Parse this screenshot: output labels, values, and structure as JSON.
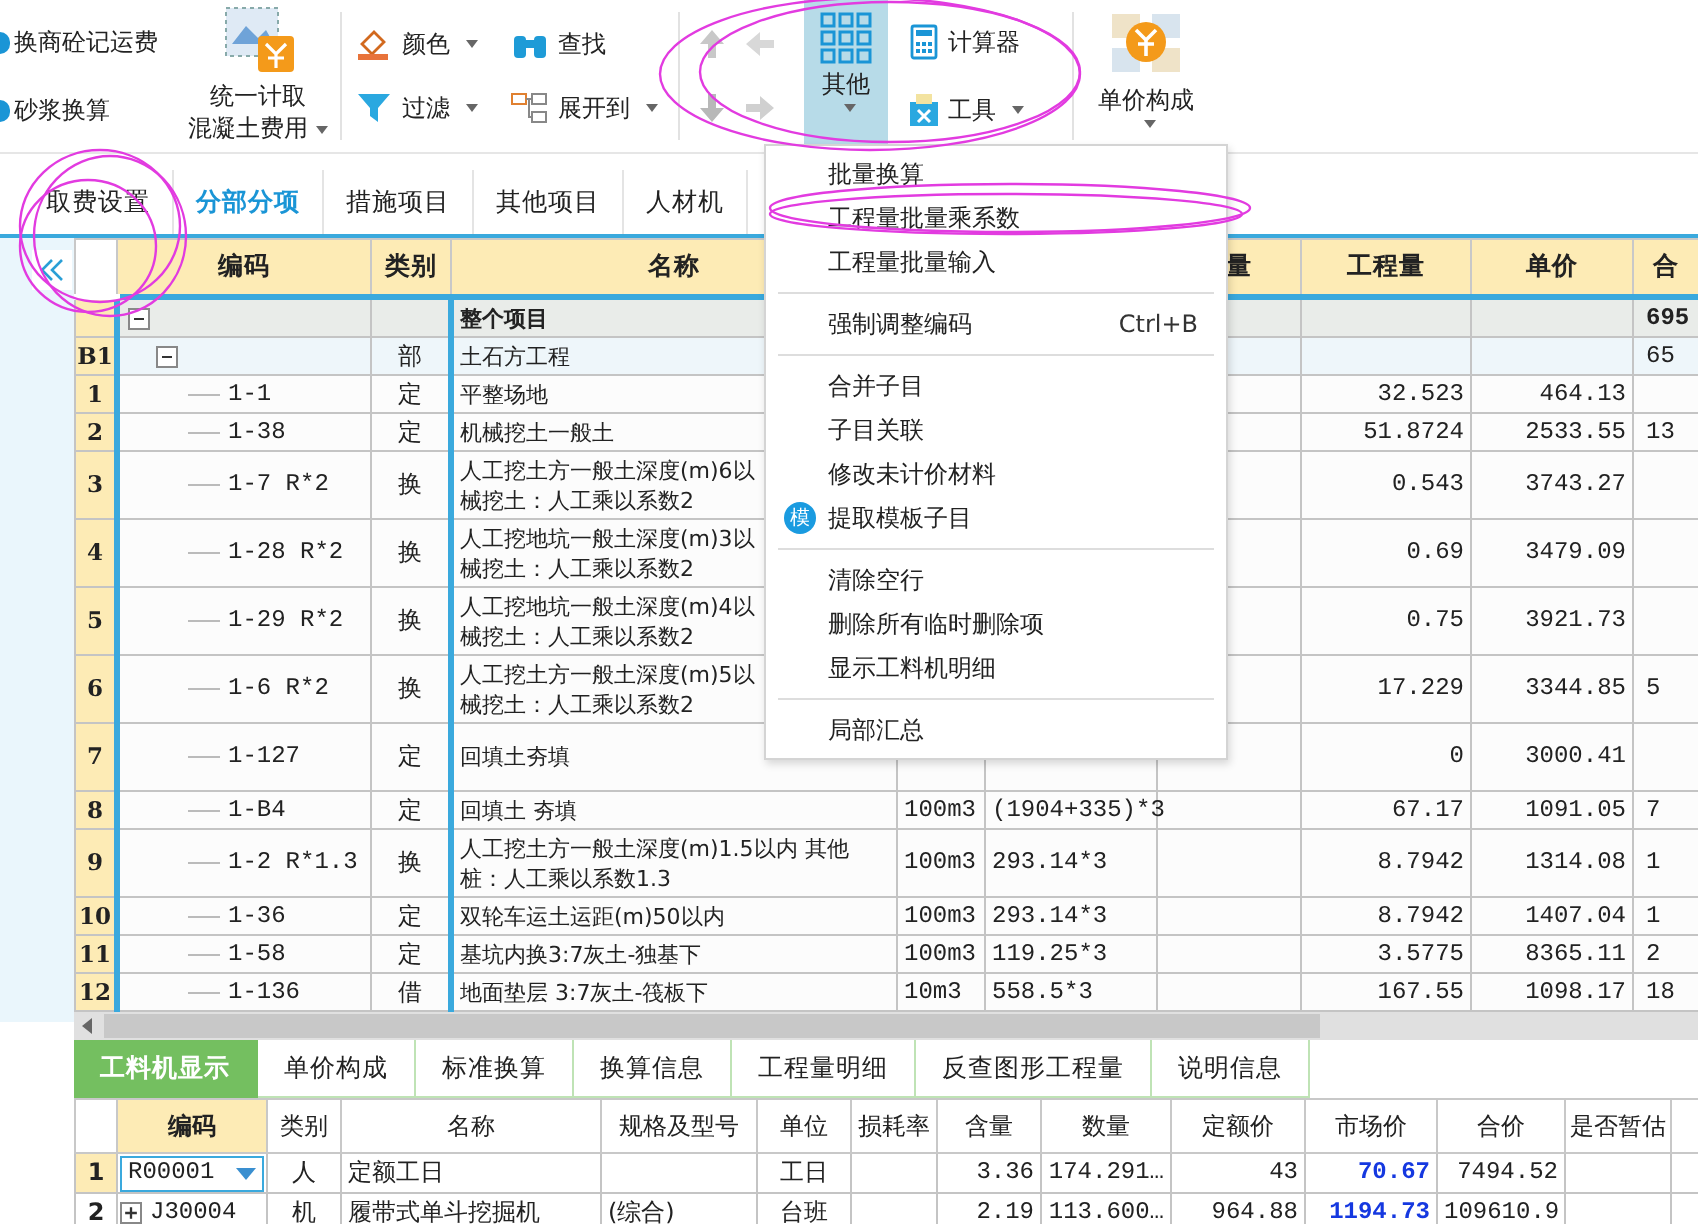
{
  "toolbar": {
    "left_items": [
      {
        "label": "换商砼记运费"
      },
      {
        "label": "砂浆换算"
      }
    ],
    "unified_button": {
      "label_lines": [
        "统一计取",
        "混凝土费用"
      ],
      "dropdown": true
    },
    "small_items": [
      {
        "label": "颜色",
        "dropdown": true
      },
      {
        "label": "查找",
        "dropdown": false
      },
      {
        "label": "过滤",
        "dropdown": true
      },
      {
        "label": "展开到",
        "dropdown": true
      }
    ],
    "other_button": {
      "label": "其他",
      "selected": true
    },
    "tool_items": [
      {
        "label": "计算器",
        "dropdown": false
      },
      {
        "label": "工具",
        "dropdown": true
      }
    ],
    "price_button": {
      "label": "单价构成"
    }
  },
  "tabs": [
    {
      "label": "取费设置",
      "selected": false
    },
    {
      "label": "分部分项",
      "selected": true
    },
    {
      "label": "措施项目",
      "selected": false
    },
    {
      "label": "其他项目",
      "selected": false
    },
    {
      "label": "人材机",
      "selected": false
    }
  ],
  "table": {
    "columns": [
      "",
      "编码",
      "类别",
      "名称",
      "",
      "",
      "量",
      "工程量",
      "单价",
      "合"
    ],
    "rows": [
      {
        "kind": "project",
        "row_no": "",
        "code": "",
        "type": "",
        "name_lines": [
          "整个项目"
        ],
        "unit": "",
        "expression": "",
        "quantity": "",
        "price": "",
        "total": "695",
        "expanded": true
      },
      {
        "kind": "section",
        "row_no": "B1",
        "code": "",
        "type": "部",
        "name_lines": [
          "土石方工程"
        ],
        "unit": "",
        "expression": "",
        "quantity": "",
        "price": "",
        "total": "65",
        "expanded": true
      },
      {
        "kind": "item",
        "row_no": "1",
        "code": "1-1",
        "type": "定",
        "name_lines": [
          "平整场地"
        ],
        "unit": "",
        "expression": "",
        "quantity": "32.523",
        "price": "464.13",
        "total": ""
      },
      {
        "kind": "item",
        "row_no": "2",
        "code": "1-38",
        "type": "定",
        "name_lines": [
          "机械挖土一般土"
        ],
        "unit": "",
        "expression": "",
        "quantity": "51.8724",
        "price": "2533.55",
        "total": "13"
      },
      {
        "kind": "item",
        "row_no": "3",
        "code": "1-7 R*2",
        "type": "换",
        "name_lines": [
          "人工挖土方一般土深度(m)6以",
          "械挖土：人工乘以系数2"
        ],
        "unit": "",
        "expression": "",
        "quantity": "0.543",
        "price": "3743.27",
        "total": ""
      },
      {
        "kind": "item",
        "row_no": "4",
        "code": "1-28 R*2",
        "type": "换",
        "name_lines": [
          "人工挖地坑一般土深度(m)3以",
          "械挖土：人工乘以系数2"
        ],
        "unit": "",
        "expression": "",
        "quantity": "0.69",
        "price": "3479.09",
        "total": ""
      },
      {
        "kind": "item",
        "row_no": "5",
        "code": "1-29 R*2",
        "type": "换",
        "name_lines": [
          "人工挖地坑一般土深度(m)4以",
          "械挖土：人工乘以系数2"
        ],
        "unit": "",
        "expression": "",
        "quantity": "0.75",
        "price": "3921.73",
        "total": ""
      },
      {
        "kind": "item",
        "row_no": "6",
        "code": "1-6 R*2",
        "type": "换",
        "name_lines": [
          "人工挖土方一般土深度(m)5以",
          "械挖土：人工乘以系数2"
        ],
        "unit": "",
        "expression": "",
        "quantity": "17.229",
        "price": "3344.85",
        "total": "5"
      },
      {
        "kind": "item",
        "row_no": "7",
        "code": "1-127",
        "type": "定",
        "name_lines": [
          "回填土夯填"
        ],
        "unit": "",
        "expression": "",
        "quantity": "0",
        "price": "3000.41",
        "total": "",
        "tall": true
      },
      {
        "kind": "item",
        "row_no": "8",
        "code": "1-B4",
        "type": "定",
        "name_lines": [
          "回填土 夯填"
        ],
        "unit": "100m3",
        "expression": "(1904+335)*3",
        "quantity": "67.17",
        "price": "1091.05",
        "total": "7"
      },
      {
        "kind": "item",
        "row_no": "9",
        "code": "1-2 R*1.3",
        "type": "换",
        "name_lines": [
          "人工挖土方一般土深度(m)1.5以内 其他",
          "桩：人工乘以系数1.3"
        ],
        "unit": "100m3",
        "expression": "293.14*3",
        "quantity": "8.7942",
        "price": "1314.08",
        "total": "1"
      },
      {
        "kind": "item",
        "row_no": "10",
        "code": "1-36",
        "type": "定",
        "name_lines": [
          "双轮车运土运距(m)50以内"
        ],
        "unit": "100m3",
        "expression": "293.14*3",
        "quantity": "8.7942",
        "price": "1407.04",
        "total": "1"
      },
      {
        "kind": "item",
        "row_no": "11",
        "code": "1-58",
        "type": "定",
        "name_lines": [
          "基坑内换3:7灰土-独基下"
        ],
        "unit": "100m3",
        "expression": "119.25*3",
        "quantity": "3.5775",
        "price": "8365.11",
        "total": "2"
      },
      {
        "kind": "item",
        "row_no": "12",
        "code": "1-136",
        "type": "借",
        "name_lines": [
          "地面垫层 3:7灰土-筏板下"
        ],
        "unit": "10m3",
        "expression": "558.5*3",
        "quantity": "167.55",
        "price": "1098.17",
        "total": "18"
      }
    ]
  },
  "context_menu": [
    {
      "kind": "item",
      "label": "批量换算"
    },
    {
      "kind": "item",
      "label": "工程量批量乘系数"
    },
    {
      "kind": "item",
      "label": "工程量批量输入"
    },
    {
      "kind": "separator"
    },
    {
      "kind": "item",
      "label": "强制调整编码",
      "shortcut": "Ctrl+B"
    },
    {
      "kind": "separator"
    },
    {
      "kind": "item",
      "label": "合并子目"
    },
    {
      "kind": "item",
      "label": "子目关联"
    },
    {
      "kind": "item",
      "label": "修改未计价材料"
    },
    {
      "kind": "item",
      "label": "提取模板子目",
      "icon_glyph": "模"
    },
    {
      "kind": "separator"
    },
    {
      "kind": "item",
      "label": "清除空行"
    },
    {
      "kind": "item",
      "label": "删除所有临时删除项"
    },
    {
      "kind": "item",
      "label": "显示工料机明细"
    },
    {
      "kind": "separator"
    },
    {
      "kind": "item",
      "label": "局部汇总"
    }
  ],
  "bottom_tabs": [
    {
      "label": "工料机显示",
      "selected": true
    },
    {
      "label": "单价构成",
      "selected": false
    },
    {
      "label": "标准换算",
      "selected": false
    },
    {
      "label": "换算信息",
      "selected": false
    },
    {
      "label": "工程量明细",
      "selected": false
    },
    {
      "label": "反查图形工程量",
      "selected": false
    },
    {
      "label": "说明信息",
      "selected": false
    }
  ],
  "bottom_table": {
    "columns": [
      {
        "selected": false
      },
      {
        "label": "编码",
        "selected": true
      },
      {
        "label": "类别",
        "selected": false
      },
      {
        "label": "名称",
        "selected": false
      },
      {
        "label": "规格及型号",
        "selected": false
      },
      {
        "label": "单位",
        "selected": false
      },
      {
        "label": "损耗率",
        "selected": false
      },
      {
        "label": "含量",
        "selected": false
      },
      {
        "label": "数量",
        "selected": false
      },
      {
        "label": "定额价",
        "selected": false
      },
      {
        "label": "市场价",
        "selected": false
      },
      {
        "label": "合价",
        "selected": false
      },
      {
        "label": "是否暂估",
        "selected": false
      }
    ],
    "rows": [
      {
        "row_no": "1",
        "selected": true,
        "editing": true,
        "code": "R00001",
        "type": "人",
        "name": "定额工日",
        "spec": "",
        "unit": "工日",
        "loss": "",
        "content": "3.36",
        "amount": "174.291…",
        "base_price": "43",
        "market_price": "70.67",
        "total": "7494.52"
      },
      {
        "row_no": "2",
        "selected": false,
        "editing": false,
        "expanded": false,
        "code": "J30004",
        "type": "机",
        "name": "履带式单斗挖掘机",
        "spec": "(综合)",
        "unit": "台班",
        "loss": "",
        "content": "2.19",
        "amount": "113.600…",
        "base_price": "964.88",
        "market_price": "1194.73",
        "total": "109610.9"
      }
    ]
  }
}
